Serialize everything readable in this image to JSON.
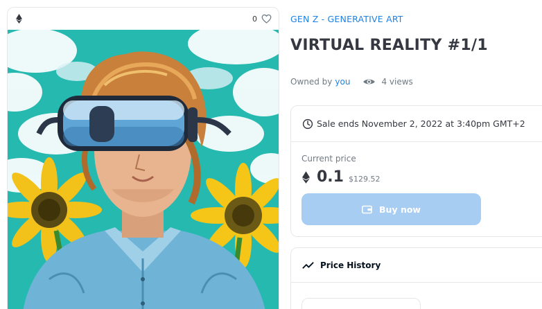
{
  "art_card": {
    "favorite_count": "0",
    "icons": {
      "chain": "ethereum-icon",
      "favorite": "heart-icon"
    }
  },
  "item": {
    "collection": "GEN Z - GENERATIVE ART",
    "title": "VIRTUAL REALITY #1/1",
    "owned_by_label": "Owned by",
    "owner": "you",
    "views": "4 views"
  },
  "sale": {
    "ends_text": "Sale ends November 2, 2022 at 3:40pm GMT+2",
    "current_price_label": "Current price",
    "price_eth": "0.1",
    "price_usd": "$129.52",
    "buy_label": "Buy now"
  },
  "price_history": {
    "title": "Price History"
  },
  "colors": {
    "link": "#2081e2",
    "text_dark": "#353840",
    "text_muted": "#707a83",
    "button_disabled": "#a8cdf3",
    "border": "#e5e8eb"
  }
}
